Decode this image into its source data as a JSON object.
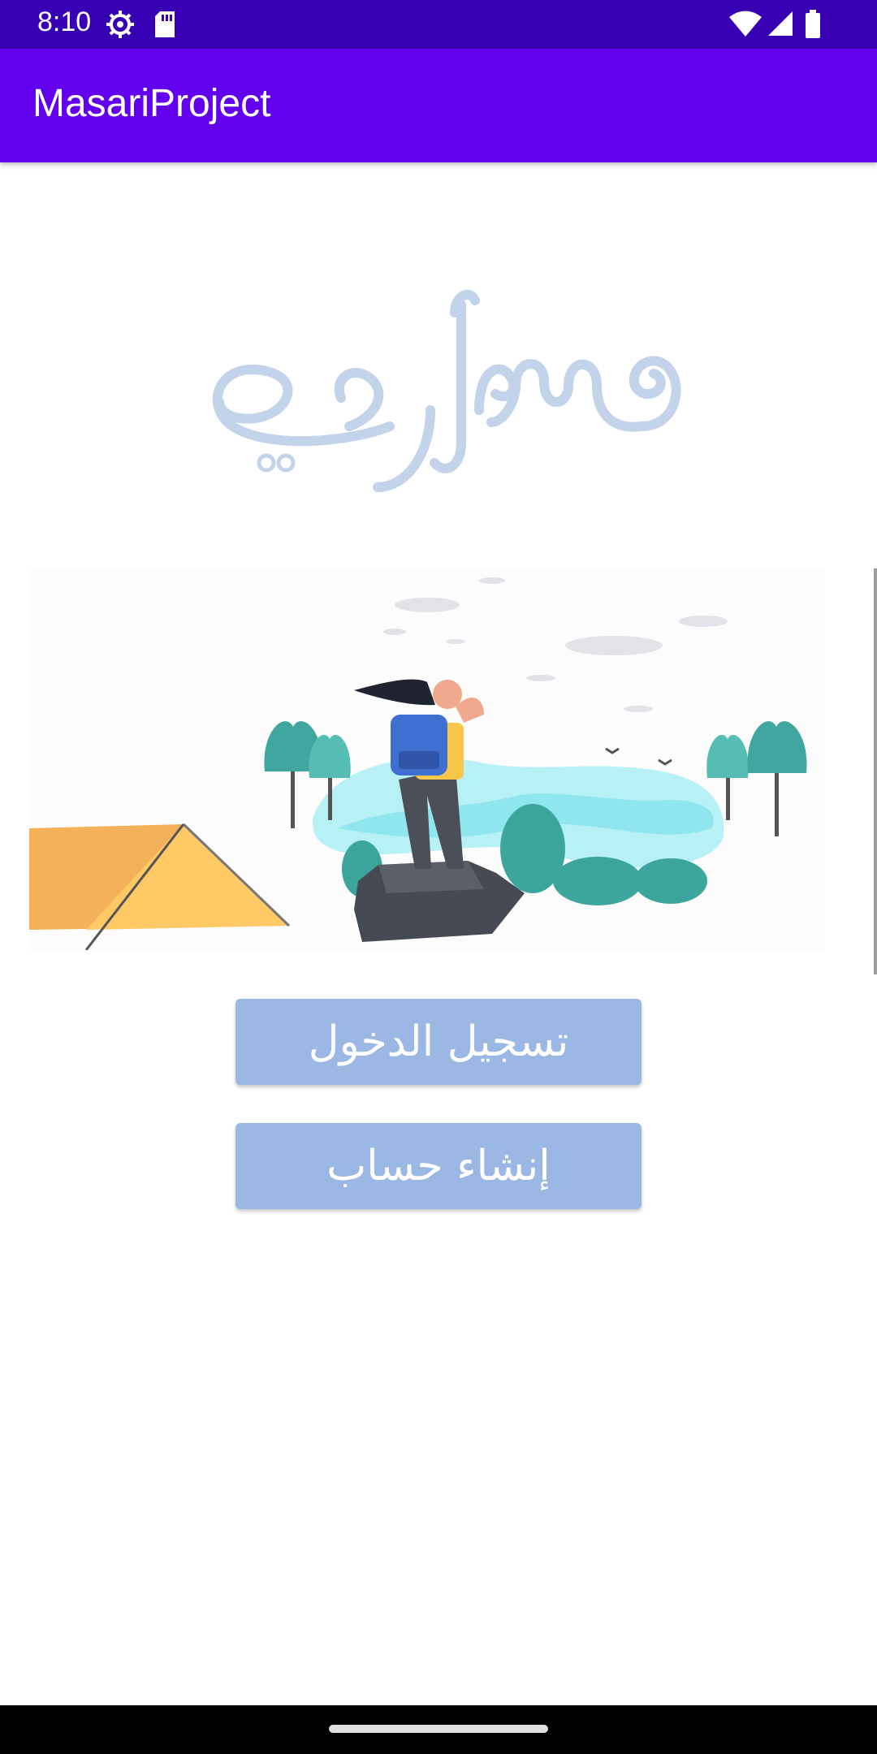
{
  "status_bar": {
    "time": "8:10",
    "icons": [
      "settings-icon",
      "sd-card-icon",
      "wifi-icon",
      "signal-icon",
      "battery-icon"
    ]
  },
  "app_bar": {
    "title": "MasariProject",
    "color": "#6200ee",
    "status_color": "#3700b3"
  },
  "logo": {
    "text": "مساري",
    "color": "#c3d3ea"
  },
  "hero": {
    "icon": "hiker-camping-illustration"
  },
  "buttons": {
    "login_label": "تسجيل الدخول",
    "register_label": "إنشاء حساب",
    "color": "#9bb7e3"
  }
}
